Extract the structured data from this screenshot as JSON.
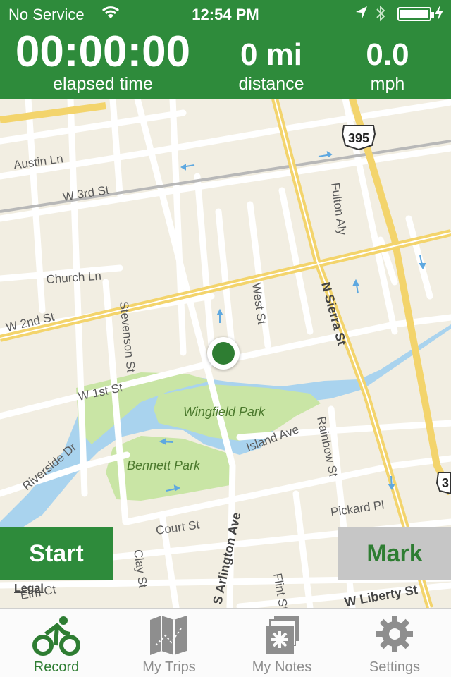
{
  "status_bar": {
    "carrier": "No Service",
    "time": "12:54 PM"
  },
  "stats": {
    "elapsed": {
      "value": "00:00:00",
      "label": "elapsed time"
    },
    "distance": {
      "value": "0 mi",
      "label": "distance"
    },
    "speed": {
      "value": "0.0",
      "label": "mph"
    }
  },
  "map": {
    "streets": {
      "austin": "Austin Ln",
      "w3rd": "W 3rd St",
      "church": "Church Ln",
      "w2nd": "W 2nd St",
      "w1st": "W 1st St",
      "stevenson": "Stevenson St",
      "west": "West St",
      "nsierra": "N Sierra St",
      "fulton": "Fulton Aly",
      "riverside": "Riverside Dr",
      "island": "Island Ave",
      "rainbow": "Rainbow St",
      "court": "Court St",
      "clay": "Clay St",
      "arlington": "S Arlington Ave",
      "flint": "Flint St",
      "pickard": "Pickard Pl",
      "wliberty": "W Liberty St",
      "elm": "Elm Ct"
    },
    "parks": {
      "wingfield": "Wingfield Park",
      "bennett": "Bennett Park"
    },
    "shields": {
      "us395": "395",
      "edge": "3"
    },
    "legal": "Legal"
  },
  "controls": {
    "start": "Start",
    "mark": "Mark"
  },
  "tabs": [
    {
      "label": "Record",
      "icon": "bicycle-icon"
    },
    {
      "label": "My Trips",
      "icon": "map-icon"
    },
    {
      "label": "My Notes",
      "icon": "notes-icon"
    },
    {
      "label": "Settings",
      "icon": "gear-icon"
    }
  ],
  "colors": {
    "brand_green": "#2e8b3b",
    "active_tab": "#2e7d32",
    "inactive_tab": "#8e8e8e",
    "map_land": "#f2eee2",
    "water": "#a9d3ee",
    "park": "#c9e5a5"
  }
}
